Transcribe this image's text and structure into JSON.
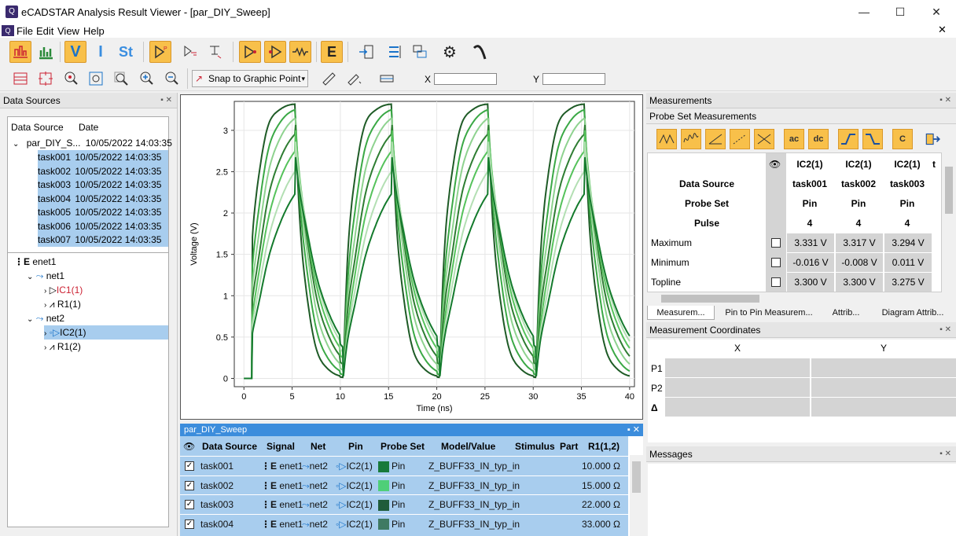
{
  "window": {
    "title": "eCADSTAR Analysis Result Viewer - [par_DIY_Sweep]",
    "minimize": "—",
    "maximize": "☐",
    "close": "✕"
  },
  "menu": [
    "File",
    "Edit",
    "View",
    "Help"
  ],
  "toolbar2": {
    "snap_label": "Snap to Graphic Point",
    "x_label": "X",
    "y_label": "Y",
    "x_value": "",
    "y_value": ""
  },
  "data_sources": {
    "title": "Data Sources",
    "col_source": "Data Source",
    "col_date": "Date",
    "root": {
      "name": "par_DIY_S...",
      "date": "10/05/2022 14:03:35"
    },
    "tasks": [
      {
        "name": "task001",
        "date": "10/05/2022 14:03:35"
      },
      {
        "name": "task002",
        "date": "10/05/2022 14:03:35"
      },
      {
        "name": "task003",
        "date": "10/05/2022 14:03:35"
      },
      {
        "name": "task004",
        "date": "10/05/2022 14:03:35"
      },
      {
        "name": "task005",
        "date": "10/05/2022 14:03:35"
      },
      {
        "name": "task006",
        "date": "10/05/2022 14:03:35"
      },
      {
        "name": "task007",
        "date": "10/05/2022 14:03:35"
      }
    ],
    "nets": {
      "root": "enet1",
      "net1": "net1",
      "ic1": "IC1(1)",
      "r1a": "R1(1)",
      "net2": "net2",
      "ic2": "IC2(1)",
      "r1b": "R1(2)"
    }
  },
  "chart_data": {
    "type": "line",
    "xlabel": "Time (ns)",
    "ylabel": "Voltage (V)",
    "xlim": [
      -1,
      40.5
    ],
    "ylim": [
      -0.1,
      3.35
    ],
    "xticks": [
      0,
      5,
      10,
      15,
      20,
      25,
      30,
      35,
      40
    ],
    "yticks": [
      0,
      0.5,
      1,
      1.5,
      2,
      2.5,
      3
    ],
    "grid": true,
    "series_colors": [
      "#1e5b26",
      "#3aa845",
      "#8ed28f",
      "#2e7d32",
      "#55c25b",
      "#b3dfb3",
      "#137a2c"
    ],
    "series_plateau": [
      3.33,
      3.31,
      3.29,
      3.2,
      3.1,
      2.95,
      2.75
    ]
  },
  "bottom_table": {
    "title": "par_DIY_Sweep",
    "headers": [
      "Data Source",
      "Signal",
      "Net",
      "Pin",
      "Probe Set",
      "Model/Value",
      "Stimulus",
      "Part",
      "R1(1,2)"
    ],
    "rows": [
      {
        "source": "task001",
        "signal": "enet1",
        "net": "net2",
        "pin": "IC2(1)",
        "probe": "Pin",
        "color": "#187a3a",
        "model": "Z_BUFF33_IN_typ_in",
        "stim": "",
        "part": "",
        "r1": "10.000 Ω"
      },
      {
        "source": "task002",
        "signal": "enet1",
        "net": "net2",
        "pin": "IC2(1)",
        "probe": "Pin",
        "color": "#4fcf78",
        "model": "Z_BUFF33_IN_typ_in",
        "stim": "",
        "part": "",
        "r1": "15.000 Ω"
      },
      {
        "source": "task003",
        "signal": "enet1",
        "net": "net2",
        "pin": "IC2(1)",
        "probe": "Pin",
        "color": "#1f5c3a",
        "model": "Z_BUFF33_IN_typ_in",
        "stim": "",
        "part": "",
        "r1": "22.000 Ω"
      },
      {
        "source": "task004",
        "signal": "enet1",
        "net": "net2",
        "pin": "IC2(1)",
        "probe": "Pin",
        "color": "#3f7a63",
        "model": "Z_BUFF33_IN_typ_in",
        "stim": "",
        "part": "",
        "r1": "33.000 Ω"
      }
    ]
  },
  "measurements": {
    "title": "Measurements",
    "sub": "Probe Set Measurements",
    "col_headers": [
      "IC2(1)",
      "IC2(1)",
      "IC2(1)"
    ],
    "labels": {
      "source": "Data Source",
      "probe": "Probe Set",
      "pulse": "Pulse"
    },
    "sources": [
      "task001",
      "task002",
      "task003"
    ],
    "probes": [
      "Pin",
      "Pin",
      "Pin"
    ],
    "pulses": [
      "4",
      "4",
      "4"
    ],
    "rows": [
      {
        "name": "Maximum",
        "values": [
          "3.331 V",
          "3.317 V",
          "3.294 V"
        ]
      },
      {
        "name": "Minimum",
        "values": [
          "-0.016 V",
          "-0.008 V",
          "0.011 V"
        ]
      },
      {
        "name": "Topline",
        "values": [
          "3.300 V",
          "3.300 V",
          "3.275 V"
        ]
      }
    ],
    "tabs": [
      "Measurem...",
      "Pin to Pin Measurem...",
      "Attrib...",
      "Diagram Attrib..."
    ],
    "btn_ac": "ac",
    "btn_dc": "dc",
    "btn_c": "C"
  },
  "coords": {
    "title": "Measurement Coordinates",
    "x": "X",
    "y": "Y",
    "rows": [
      "P1",
      "P2",
      "Δ"
    ]
  },
  "messages": {
    "title": "Messages"
  }
}
